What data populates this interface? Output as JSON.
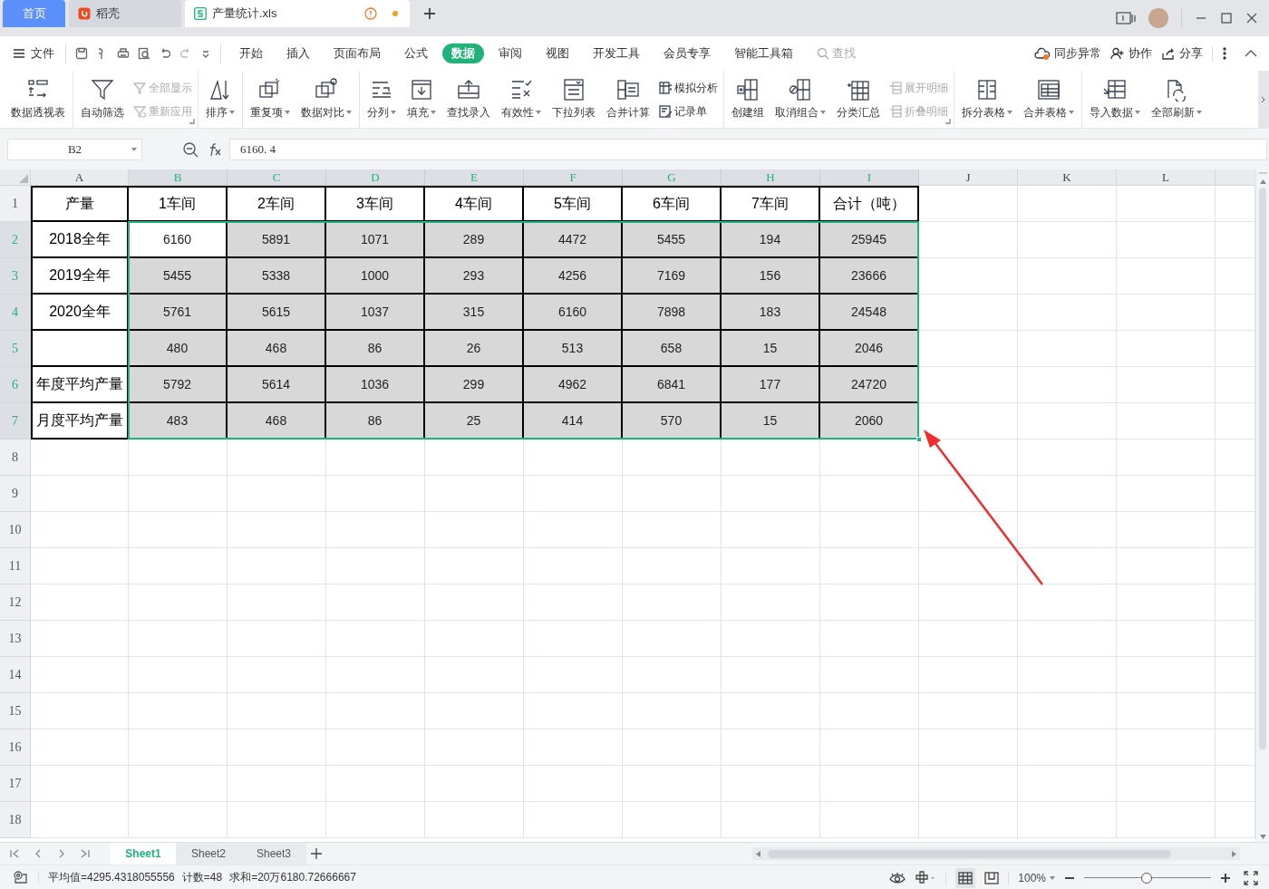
{
  "tabs": [
    {
      "label": "首页",
      "kind": "home",
      "selected": false
    },
    {
      "label": "稻壳",
      "kind": "app",
      "selected": false
    },
    {
      "label": "产量统计.xls",
      "kind": "document",
      "selected": true,
      "unsaved": true
    }
  ],
  "menu": {
    "file": "文件",
    "tabs": [
      {
        "label": "开始",
        "selected": false
      },
      {
        "label": "插入",
        "selected": false
      },
      {
        "label": "页面布局",
        "selected": false
      },
      {
        "label": "公式",
        "selected": false
      },
      {
        "label": "数据",
        "selected": true
      },
      {
        "label": "审阅",
        "selected": false
      },
      {
        "label": "视图",
        "selected": false
      },
      {
        "label": "开发工具",
        "selected": false
      },
      {
        "label": "会员专享",
        "selected": false
      },
      {
        "label": "智能工具箱",
        "selected": false
      }
    ],
    "search_placeholder": "查找",
    "actions": [
      "同步异常",
      "协作",
      "分享"
    ]
  },
  "ribbon": [
    {
      "launcher": false,
      "items": [
        {
          "label": "数据透视表",
          "kind": "large",
          "dropdown": false,
          "disabled": false
        }
      ]
    },
    {
      "launcher": true,
      "items": [
        {
          "label": "自动筛选",
          "kind": "large",
          "dropdown": false,
          "disabled": false
        },
        {
          "label": "全部显示",
          "kind": "small",
          "dropdown": false,
          "disabled": true
        },
        {
          "label": "重新应用",
          "kind": "small",
          "dropdown": false,
          "disabled": true
        }
      ]
    },
    {
      "launcher": false,
      "items": [
        {
          "label": "排序",
          "kind": "large",
          "dropdown": true,
          "disabled": false
        }
      ]
    },
    {
      "launcher": false,
      "items": [
        {
          "label": "重复项",
          "kind": "large",
          "dropdown": true,
          "disabled": false
        },
        {
          "label": "数据对比",
          "kind": "large",
          "dropdown": true,
          "disabled": false
        }
      ]
    },
    {
      "launcher": false,
      "items": [
        {
          "label": "分列",
          "kind": "large",
          "dropdown": true,
          "disabled": false
        },
        {
          "label": "填充",
          "kind": "large",
          "dropdown": true,
          "disabled": false
        },
        {
          "label": "查找录入",
          "kind": "large",
          "dropdown": false,
          "disabled": false
        },
        {
          "label": "有效性",
          "kind": "large",
          "dropdown": true,
          "disabled": false
        },
        {
          "label": "下拉列表",
          "kind": "large",
          "dropdown": false,
          "disabled": false
        },
        {
          "label": "合并计算",
          "kind": "large",
          "dropdown": false,
          "disabled": false
        },
        {
          "label": "模拟分析",
          "kind": "small",
          "dropdown": false,
          "disabled": false
        },
        {
          "label": "记录单",
          "kind": "small",
          "dropdown": false,
          "disabled": false
        }
      ]
    },
    {
      "launcher": true,
      "items": [
        {
          "label": "创建组",
          "kind": "large",
          "dropdown": false,
          "disabled": false
        },
        {
          "label": "取消组合",
          "kind": "large",
          "dropdown": true,
          "disabled": false
        },
        {
          "label": "分类汇总",
          "kind": "large",
          "dropdown": false,
          "disabled": false
        },
        {
          "label": "展开明细",
          "kind": "small",
          "dropdown": false,
          "disabled": true
        },
        {
          "label": "折叠明细",
          "kind": "small",
          "dropdown": false,
          "disabled": true
        }
      ]
    },
    {
      "launcher": false,
      "items": [
        {
          "label": "拆分表格",
          "kind": "large",
          "dropdown": true,
          "disabled": false
        },
        {
          "label": "合并表格",
          "kind": "large",
          "dropdown": true,
          "disabled": false
        }
      ]
    },
    {
      "launcher": false,
      "items": [
        {
          "label": "导入数据",
          "kind": "large",
          "dropdown": true,
          "disabled": false
        },
        {
          "label": "全部刷新",
          "kind": "large",
          "dropdown": true,
          "disabled": false
        }
      ]
    }
  ],
  "formula_bar": {
    "name_box": "B2",
    "value": "6160. 4"
  },
  "columns": [
    {
      "label": "A",
      "selected": false
    },
    {
      "label": "B",
      "selected": true
    },
    {
      "label": "C",
      "selected": true
    },
    {
      "label": "D",
      "selected": true
    },
    {
      "label": "E",
      "selected": true
    },
    {
      "label": "F",
      "selected": true
    },
    {
      "label": "G",
      "selected": true
    },
    {
      "label": "H",
      "selected": true
    },
    {
      "label": "I",
      "selected": true
    },
    {
      "label": "J",
      "selected": false
    },
    {
      "label": "K",
      "selected": false
    },
    {
      "label": "L",
      "selected": false
    }
  ],
  "rows": [
    {
      "header": "1",
      "selected": false,
      "cells": [
        {
          "text": "产量",
          "selected": false
        },
        {
          "text": "1车间",
          "selected": false
        },
        {
          "text": "2车间",
          "selected": false
        },
        {
          "text": "3车间",
          "selected": false
        },
        {
          "text": "4车间",
          "selected": false
        },
        {
          "text": "5车间",
          "selected": false
        },
        {
          "text": "6车间",
          "selected": false
        },
        {
          "text": "7车间",
          "selected": false
        },
        {
          "text": "合计（吨）",
          "selected": false
        }
      ]
    },
    {
      "header": "2",
      "selected": true,
      "cells": [
        {
          "text": "2018全年",
          "selected": false
        },
        {
          "text": "6160",
          "selected": false
        },
        {
          "text": "5891",
          "selected": true
        },
        {
          "text": "1071",
          "selected": true
        },
        {
          "text": "289",
          "selected": true
        },
        {
          "text": "4472",
          "selected": true
        },
        {
          "text": "5455",
          "selected": true
        },
        {
          "text": "194",
          "selected": true
        },
        {
          "text": "25945",
          "selected": true
        }
      ]
    },
    {
      "header": "3",
      "selected": true,
      "cells": [
        {
          "text": "2019全年",
          "selected": false
        },
        {
          "text": "5455",
          "selected": true
        },
        {
          "text": "5338",
          "selected": true
        },
        {
          "text": "1000",
          "selected": true
        },
        {
          "text": "293",
          "selected": true
        },
        {
          "text": "4256",
          "selected": true
        },
        {
          "text": "7169",
          "selected": true
        },
        {
          "text": "156",
          "selected": true
        },
        {
          "text": "23666",
          "selected": true
        }
      ]
    },
    {
      "header": "4",
      "selected": true,
      "cells": [
        {
          "text": "2020全年",
          "selected": false
        },
        {
          "text": "5761",
          "selected": true
        },
        {
          "text": "5615",
          "selected": true
        },
        {
          "text": "1037",
          "selected": true
        },
        {
          "text": "315",
          "selected": true
        },
        {
          "text": "6160",
          "selected": true
        },
        {
          "text": "7898",
          "selected": true
        },
        {
          "text": "183",
          "selected": true
        },
        {
          "text": "24548",
          "selected": true
        }
      ]
    },
    {
      "header": "5",
      "selected": true,
      "cells": [
        {
          "text": "",
          "selected": false
        },
        {
          "text": "480",
          "selected": true
        },
        {
          "text": "468",
          "selected": true
        },
        {
          "text": "86",
          "selected": true
        },
        {
          "text": "26",
          "selected": true
        },
        {
          "text": "513",
          "selected": true
        },
        {
          "text": "658",
          "selected": true
        },
        {
          "text": "15",
          "selected": true
        },
        {
          "text": "2046",
          "selected": true
        }
      ]
    },
    {
      "header": "6",
      "selected": true,
      "cells": [
        {
          "text": "年度平均产量",
          "selected": false
        },
        {
          "text": "5792",
          "selected": true
        },
        {
          "text": "5614",
          "selected": true
        },
        {
          "text": "1036",
          "selected": true
        },
        {
          "text": "299",
          "selected": true
        },
        {
          "text": "4962",
          "selected": true
        },
        {
          "text": "6841",
          "selected": true
        },
        {
          "text": "177",
          "selected": true
        },
        {
          "text": "24720",
          "selected": true
        }
      ]
    },
    {
      "header": "7",
      "selected": true,
      "cells": [
        {
          "text": "月度平均产量",
          "selected": false
        },
        {
          "text": "483",
          "selected": true
        },
        {
          "text": "468",
          "selected": true
        },
        {
          "text": "86",
          "selected": true
        },
        {
          "text": "25",
          "selected": true
        },
        {
          "text": "414",
          "selected": true
        },
        {
          "text": "570",
          "selected": true
        },
        {
          "text": "15",
          "selected": true
        },
        {
          "text": "2060",
          "selected": true
        }
      ]
    },
    {
      "header": "8",
      "selected": false
    },
    {
      "header": "9",
      "selected": false
    },
    {
      "header": "10",
      "selected": false
    },
    {
      "header": "11",
      "selected": false
    },
    {
      "header": "12",
      "selected": false
    },
    {
      "header": "13",
      "selected": false
    },
    {
      "header": "14",
      "selected": false
    },
    {
      "header": "15",
      "selected": false
    },
    {
      "header": "16",
      "selected": false
    },
    {
      "header": "17",
      "selected": false
    },
    {
      "header": "18",
      "selected": false
    }
  ],
  "sheets": [
    {
      "label": "Sheet1",
      "selected": true
    },
    {
      "label": "Sheet2",
      "selected": false
    },
    {
      "label": "Sheet3",
      "selected": false
    }
  ],
  "status": {
    "stats": [
      "平均值=4295.4318055556",
      "计数=48",
      "求和=20万6180.72666667"
    ],
    "zoom": "100%",
    "zoom_slider": {
      "level": 0.49
    }
  }
}
